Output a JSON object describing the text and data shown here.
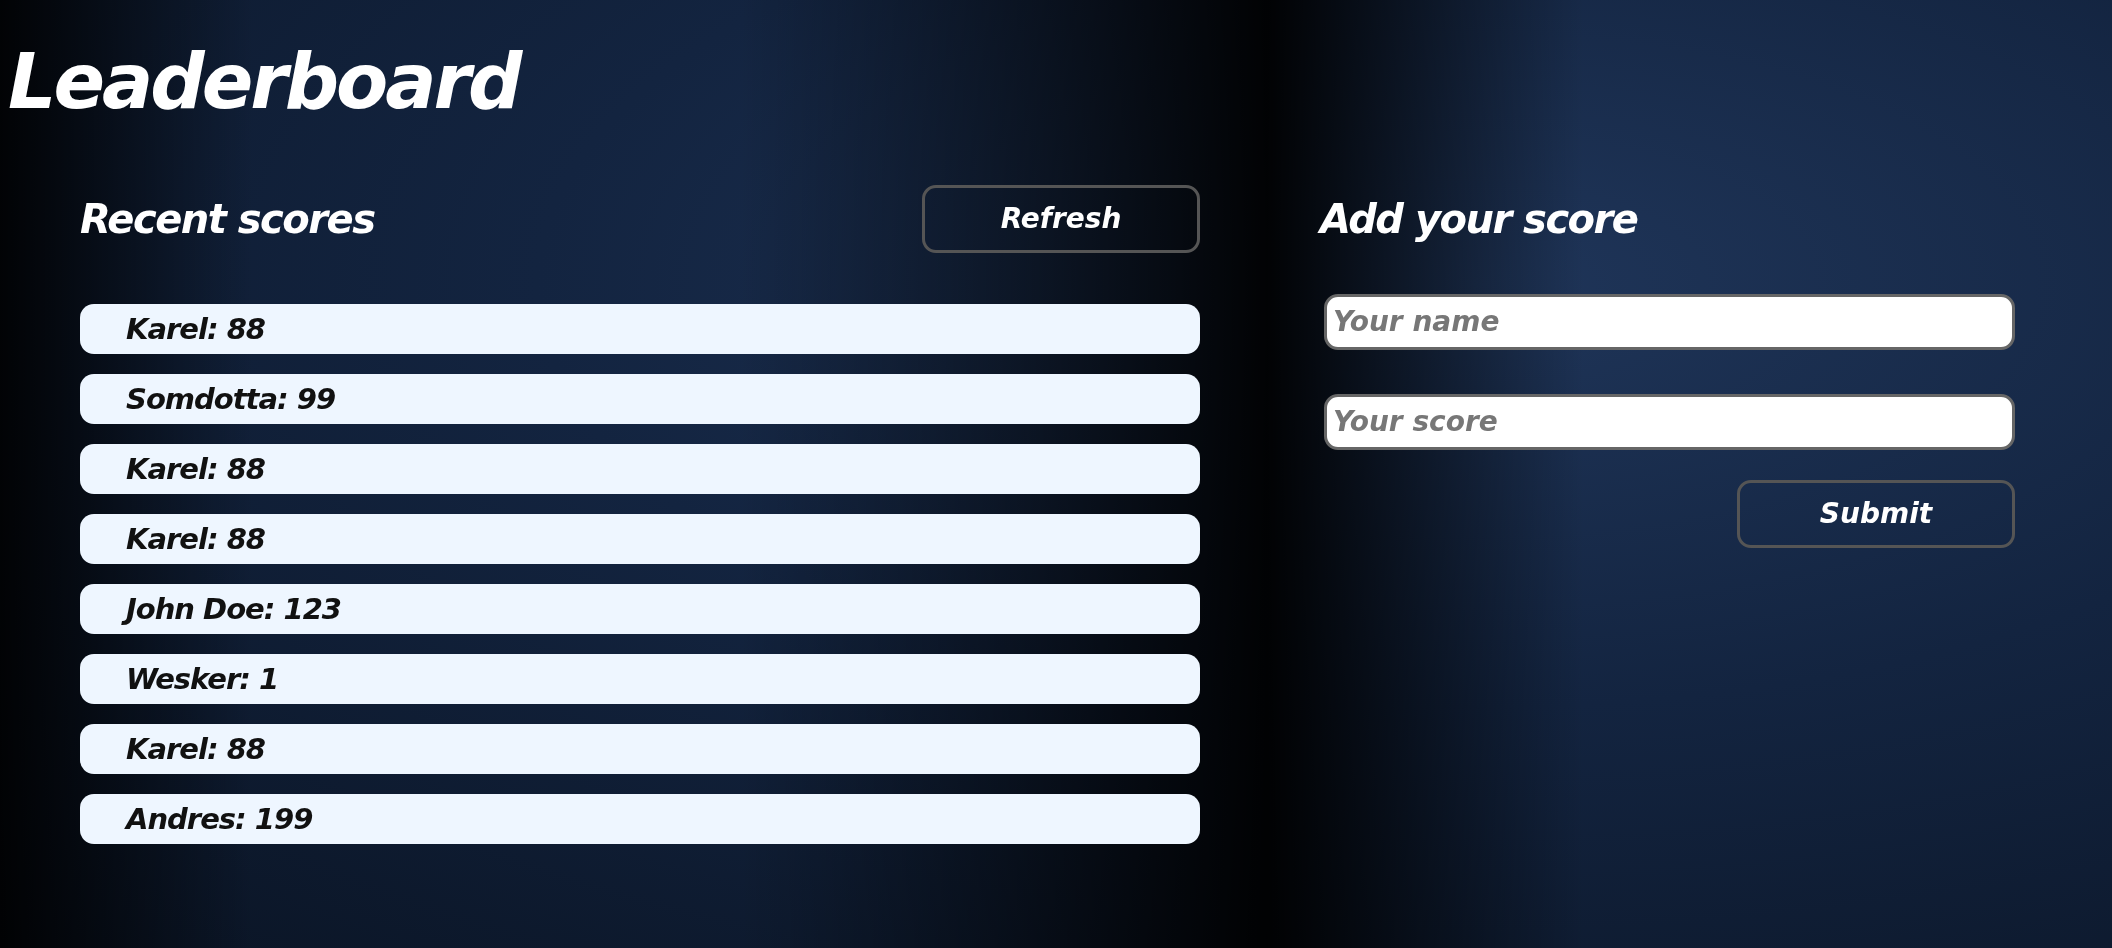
{
  "title": "Leaderboard",
  "recent": {
    "heading": "Recent scores",
    "refresh": "Refresh",
    "scores": [
      "Karel: 88",
      "Somdotta: 99",
      "Karel: 88",
      "Karel: 88",
      "John Doe: 123",
      "Wesker: 1",
      "Karel: 88",
      "Andres: 199"
    ]
  },
  "add": {
    "heading": "Add your score",
    "name_placeholder": "Your name",
    "score_placeholder": "Your score",
    "submit": "Submit"
  }
}
